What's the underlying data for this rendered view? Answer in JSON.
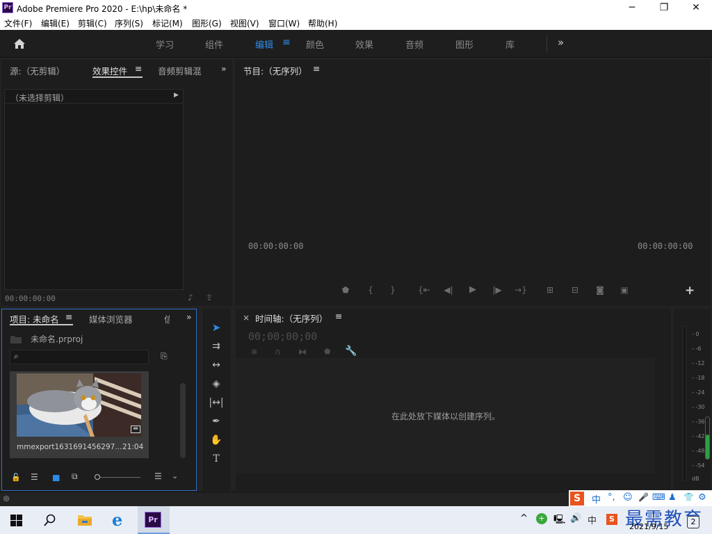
{
  "window": {
    "title": "Adobe Premiere Pro 2020 - E:\\hp\\未命名 *",
    "app_icon_text": "Pr",
    "minimize": "─",
    "maximize": "❐",
    "close": "✕"
  },
  "menu": [
    "文件(F)",
    "编辑(E)",
    "剪辑(C)",
    "序列(S)",
    "标记(M)",
    "图形(G)",
    "视图(V)",
    "窗口(W)",
    "帮助(H)"
  ],
  "workspaces": [
    "学习",
    "组件",
    "编辑",
    "颜色",
    "效果",
    "音频",
    "图形",
    "库"
  ],
  "workspace_active": "编辑",
  "more_glyph": "»",
  "menu_glyph": "≡",
  "source_panel": {
    "tabs": [
      "源:（无剪辑）",
      "效果控件",
      "音频剪辑混"
    ],
    "no_clip": "（未选择剪辑）",
    "timecode": "00:00:00:00"
  },
  "program_panel": {
    "title": "节目:（无序列）",
    "timecode_left": "00:00:00:00",
    "timecode_right": "00:00:00:00"
  },
  "project_panel": {
    "tabs": [
      "项目: 未命名",
      "媒体浏览器",
      "信"
    ],
    "project_file": "未命名.prproj",
    "item_name": "mmexport1631691456297...",
    "item_duration": "21:04"
  },
  "timeline_panel": {
    "title": "时间轴:（无序列）",
    "close_glyph": "×",
    "timecode": "00;00;00;00",
    "drop_hint": "在此处放下媒体以创建序列。"
  },
  "meter_labels": [
    "- 0",
    "- -6",
    "- -12",
    "- -18",
    "- -24",
    "- -30",
    "- -36",
    "- -42",
    "- -48",
    "- -54",
    "dB"
  ],
  "taskbar": {
    "ime_items": [
      "中",
      "°,",
      "☺",
      "🎤",
      "⌨",
      "♟",
      "👕",
      "⚙"
    ],
    "tray_ime": "中",
    "date": "2021/9/15",
    "notify_count": "2",
    "watermark": "最需教育"
  }
}
